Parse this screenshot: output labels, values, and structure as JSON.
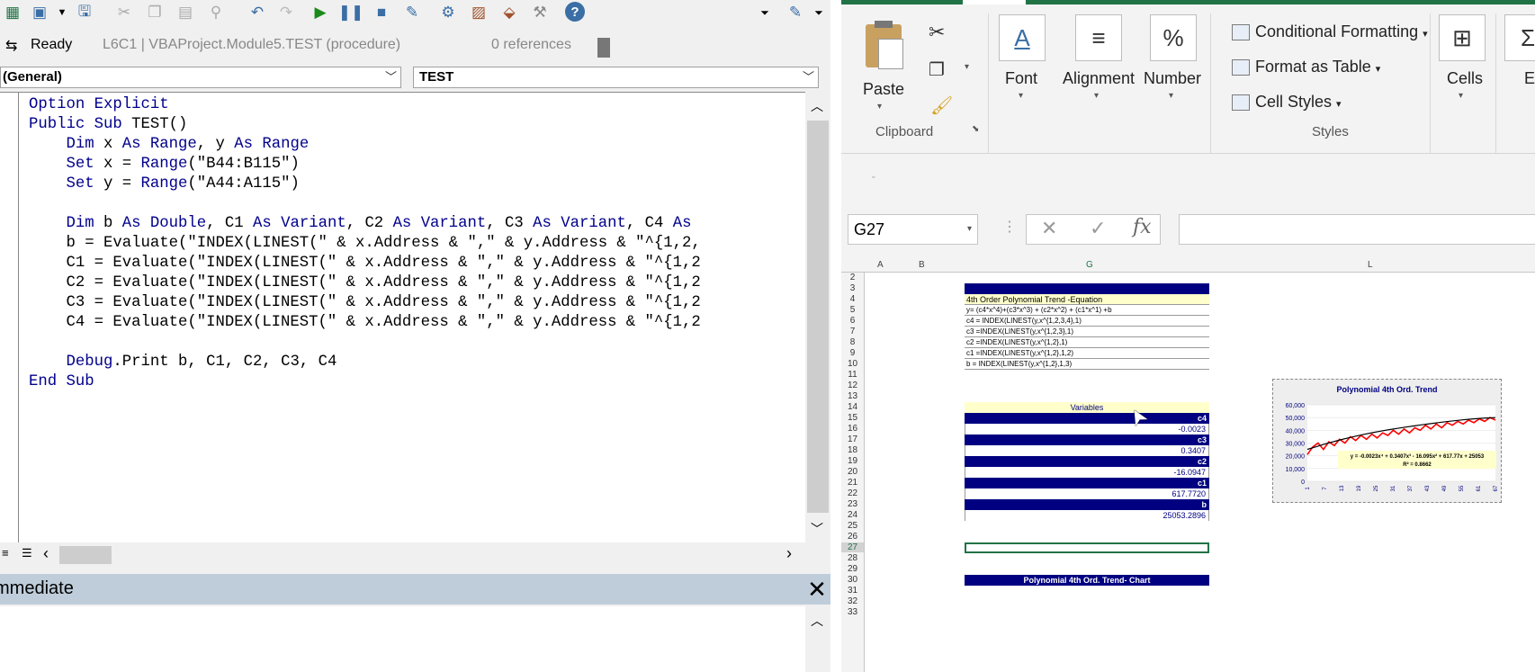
{
  "vbe": {
    "status": {
      "ready": "Ready",
      "location": "L6C1 | VBAProject.Module5.TEST (procedure)",
      "references": "0 references"
    },
    "object_combo": "(General)",
    "proc_combo": "TEST",
    "code_lines": [
      "Option Explicit",
      "Public Sub TEST()",
      "    Dim x As Range, y As Range",
      "    Set x = Range(\"B44:B115\")",
      "    Set y = Range(\"A44:A115\")",
      "",
      "    Dim b As Double, C1 As Variant, C2 As Variant, C3 As Variant, C4 As",
      "    b = Evaluate(\"INDEX(LINEST(\" & x.Address & \",\" & y.Address & \"^{1,2,",
      "    C1 = Evaluate(\"INDEX(LINEST(\" & x.Address & \",\" & y.Address & \"^{1,2",
      "    C2 = Evaluate(\"INDEX(LINEST(\" & x.Address & \",\" & y.Address & \"^{1,2",
      "    C3 = Evaluate(\"INDEX(LINEST(\" & x.Address & \",\" & y.Address & \"^{1,2",
      "    C4 = Evaluate(\"INDEX(LINEST(\" & x.Address & \",\" & y.Address & \"^{1,2",
      "",
      "    Debug.Print b, C1, C2, C3, C4",
      "End Sub"
    ],
    "immediate_title": "mmediate",
    "close_glyph": "✕"
  },
  "excel": {
    "ribbon": {
      "paste": "Paste",
      "clipboard": "Clipboard",
      "font": "Font",
      "alignment": "Alignment",
      "number": "Number",
      "conditional_formatting": "Conditional Formatting",
      "format_as_table": "Format as Table",
      "cell_styles": "Cell Styles",
      "styles": "Styles",
      "cells": "Cells",
      "edit_partial": "E"
    },
    "name_box": "G27",
    "formula_value": "",
    "columns": [
      "A",
      "B",
      "G",
      "L"
    ],
    "rows": [
      "2",
      "3",
      "4",
      "5",
      "6",
      "7",
      "8",
      "9",
      "10",
      "11",
      "12",
      "13",
      "14",
      "15",
      "16",
      "17",
      "18",
      "19",
      "20",
      "21",
      "22",
      "23",
      "24",
      "25",
      "26",
      "27",
      "28",
      "29",
      "30",
      "31",
      "32",
      "33"
    ],
    "sheet": {
      "eq_title": "4th Order Polynomial Trend -Equation",
      "eq_rows": [
        "y= (c4*x^4)+(c3*x^3) + (c2*x^2) + (c1*x^1) +b",
        "c4 = INDEX(LINEST(y,x^{1,2,3,4},1)",
        "c3 =INDEX(LINEST(y,x^{1,2,3},1)",
        "c2 =INDEX(LINEST(y,x^{1,2},1)",
        "c1 =INDEX(LINEST(y,x^{1,2},1,2)",
        "b = INDEX(LINEST(y,x^{1,2},1,3)"
      ],
      "variables_title": "Variables",
      "variables": [
        {
          "label": "c4",
          "value": "-0.0023"
        },
        {
          "label": "c3",
          "value": "0.3407"
        },
        {
          "label": "c2",
          "value": "-16.0947"
        },
        {
          "label": "c1",
          "value": "617.7720"
        },
        {
          "label": "b",
          "value": "25053.2896"
        }
      ],
      "chart_banner": "Polynomial 4th Ord. Trend- Chart"
    }
  },
  "chart_data": {
    "type": "line",
    "title": "Polynomial 4th Ord. Trend",
    "ylim": [
      0,
      60000
    ],
    "y_ticks": [
      "60,000",
      "50,000",
      "40,000",
      "30,000",
      "20,000",
      "10,000",
      "0"
    ],
    "x_ticks": [
      "1",
      "7",
      "13",
      "19",
      "25",
      "31",
      "37",
      "43",
      "49",
      "55",
      "61",
      "67"
    ],
    "series": [
      {
        "color": "#ff0000",
        "values": [
          21000,
          27000,
          30000,
          25000,
          31000,
          28000,
          33000,
          30000,
          35000,
          32000,
          36000,
          33000,
          37000,
          34000,
          38000,
          36000,
          40000,
          37000,
          41000,
          38000,
          42000,
          40000,
          44000,
          41000,
          45000,
          42000,
          46000,
          44000,
          47000,
          45000,
          48000,
          46000,
          49000,
          47000,
          50000,
          48000
        ]
      },
      {
        "color": "#000000",
        "values": [
          25053,
          27000,
          29000,
          30800,
          32500,
          34000,
          35500,
          36900,
          38200,
          39400,
          40500,
          41500,
          42500,
          43400,
          44300,
          45200,
          46000,
          46800,
          47500,
          48200,
          48800,
          49300,
          49700,
          50000
        ]
      }
    ],
    "annotation_eq": "y = -0.0023x⁴ + 0.3407x³ - 16.095x² + 617.77x + 25053",
    "annotation_r2": "R² = 0.8662"
  }
}
